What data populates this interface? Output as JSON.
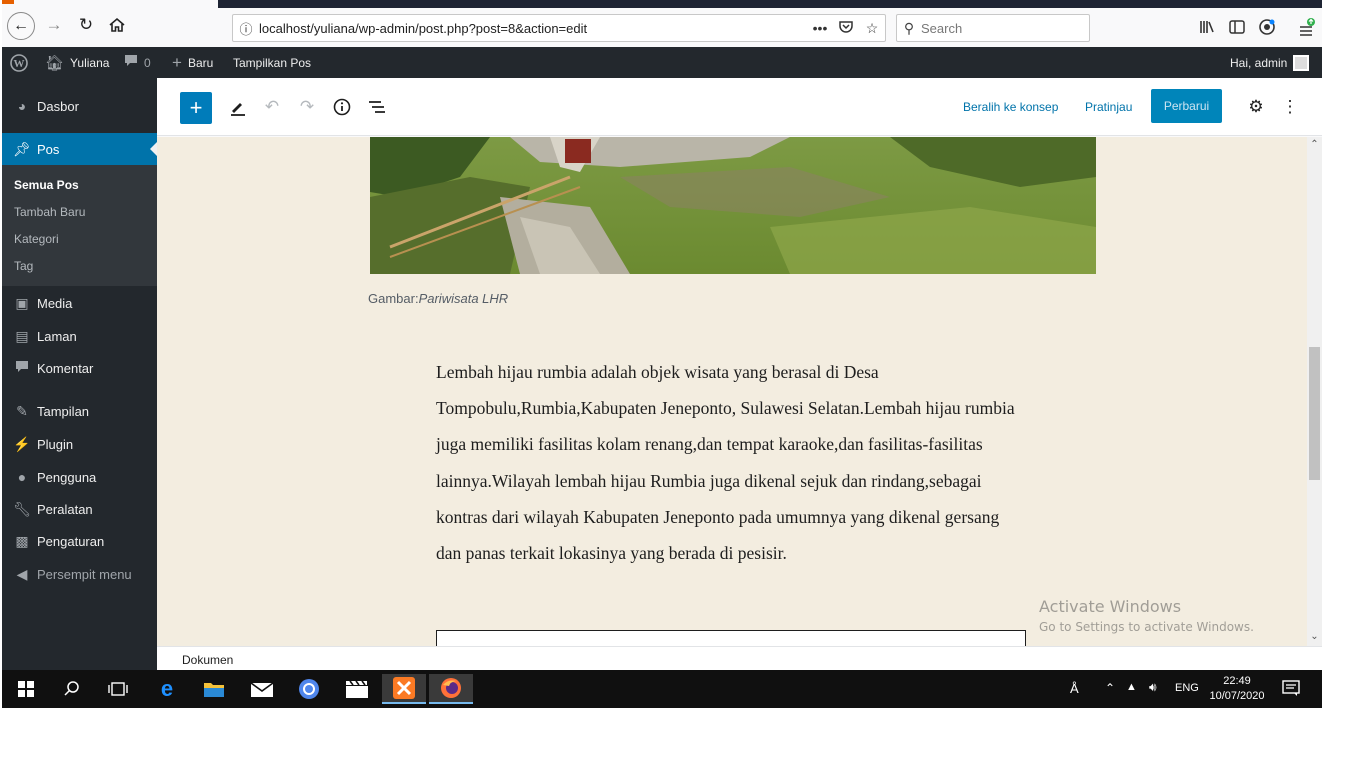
{
  "browser": {
    "url": "localhost/yuliana/wp-admin/post.php?post=8&action=edit",
    "search_placeholder": "Search",
    "more_label": "•••"
  },
  "adminbar": {
    "site_name": "Yuliana",
    "comments_count": "0",
    "new_label": "Baru",
    "view_post_label": "Tampilkan Pos",
    "greeting": "Hai, admin"
  },
  "sidebar": {
    "dashboard": "Dasbor",
    "posts": "Pos",
    "submenu": [
      "Semua Pos",
      "Tambah Baru",
      "Kategori",
      "Tag"
    ],
    "media": "Media",
    "pages": "Laman",
    "comments": "Komentar",
    "appearance": "Tampilan",
    "plugins": "Plugin",
    "users": "Pengguna",
    "tools": "Peralatan",
    "settings": "Pengaturan",
    "collapse": "Persempit menu"
  },
  "editor": {
    "switch_to_draft": "Beralih ke konsep",
    "preview": "Pratinjau",
    "update": "Perbarui",
    "caption_prefix": "Gambar:",
    "caption_italic": "Pariwisata LHR",
    "paragraph": "Lembah hijau rumbia adalah objek wisata yang berasal di Desa Tompobulu,Rumbia,Kabupaten Jeneponto, Sulawesi Selatan.Lembah hijau rumbia juga memiliki fasilitas kolam renang,dan tempat karaoke,dan fasilitas-fasilitas lainnya.Wilayah lembah hijau Rumbia juga dikenal sejuk dan rindang,sebagai kontras dari wilayah Kabupaten Jeneponto pada umumnya yang dikenal gersang dan panas terkait lokasinya yang berada di pesisir.",
    "footer_breadcrumb": "Dokumen"
  },
  "watermark": {
    "title": "Activate Windows",
    "subtitle": "Go to Settings to activate Windows."
  },
  "taskbar": {
    "language": "ENG",
    "time": "22:49",
    "date": "10/07/2020"
  },
  "colors": {
    "wp_blue": "#0073aa",
    "admin_dark": "#23282d",
    "content_bg": "#f3ede0",
    "update_button": "#0085ba"
  }
}
